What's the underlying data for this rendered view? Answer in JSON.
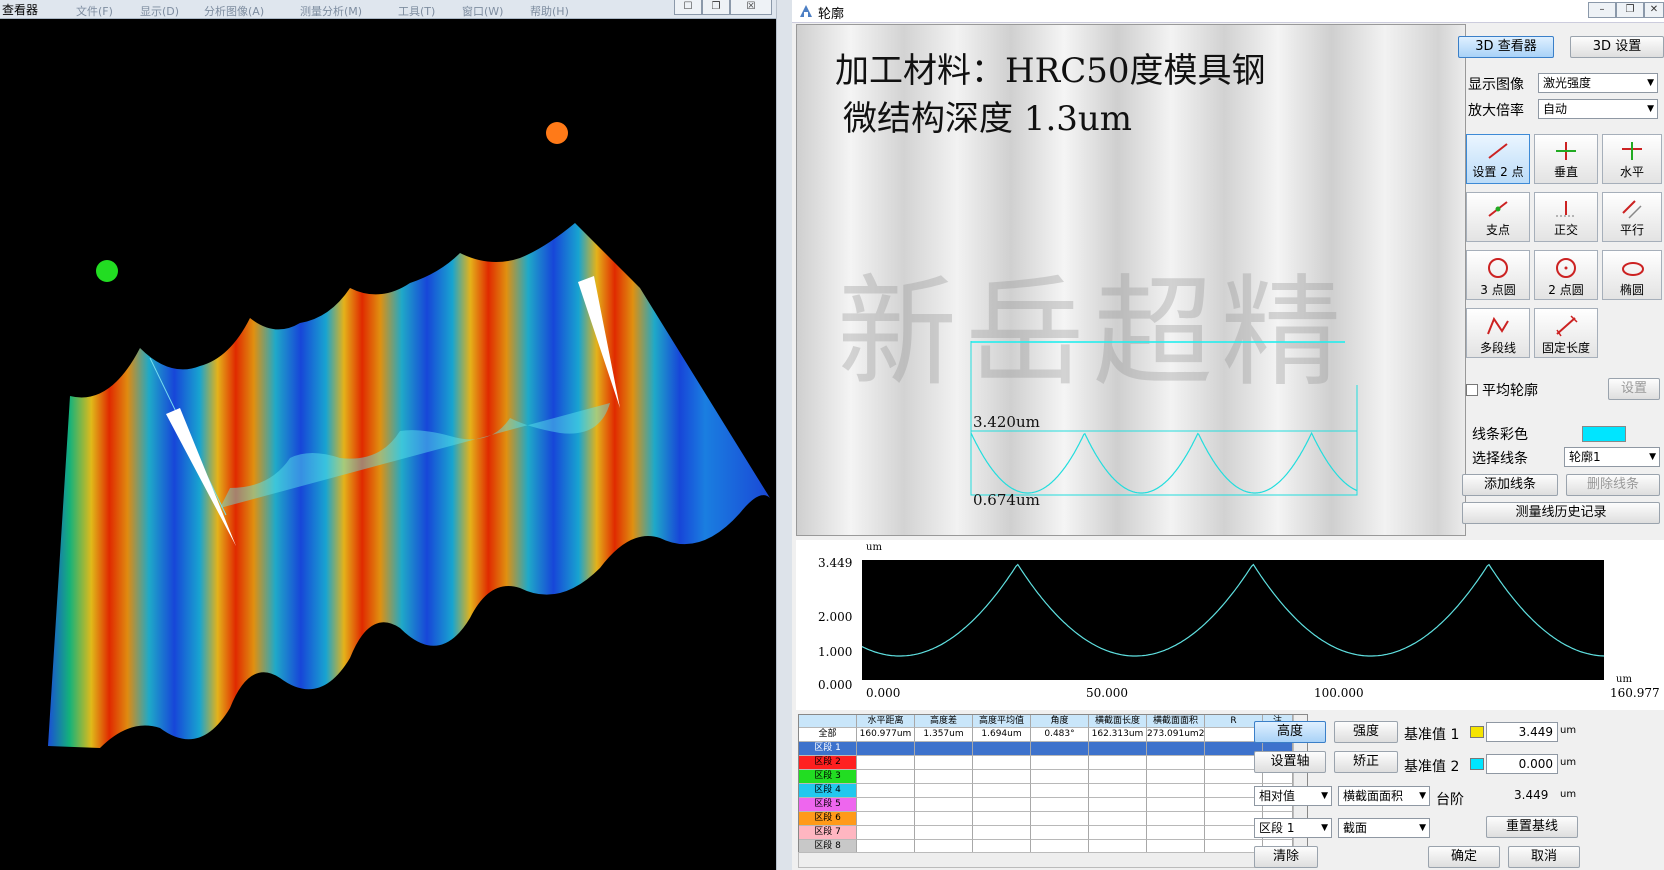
{
  "viewer": {
    "title": "查看器",
    "menu": [
      "文件(F)",
      "显示(D)",
      "分析图像(A)",
      "测量分析(M)",
      "工具(T)",
      "窗口(W)",
      "帮助(H)"
    ],
    "window_buttons": [
      "☐",
      "❐",
      "☒"
    ]
  },
  "profile": {
    "title": "轮廓",
    "window_buttons": [
      "–",
      "❐",
      "✕"
    ],
    "image": {
      "line1": "加工材料：HRC50度模具钢",
      "line2": "微结构深度 1.3um",
      "watermark": "新岳超精",
      "top_label": "3.420um",
      "bottom_label": "0.674um"
    },
    "panel": {
      "tab_3d_viewer": "3D 查看器",
      "tab_3d_settings": "3D 设置",
      "display_image_label": "显示图像",
      "display_image_value": "激光强度",
      "zoom_label": "放大倍率",
      "zoom_value": "自动",
      "tools": [
        {
          "label": "设置 2 点",
          "icon": "two-point-line-icon"
        },
        {
          "label": "垂直",
          "icon": "vertical-icon"
        },
        {
          "label": "水平",
          "icon": "horizontal-icon"
        },
        {
          "label": "支点",
          "icon": "pivot-icon"
        },
        {
          "label": "正交",
          "icon": "orthogonal-icon"
        },
        {
          "label": "平行",
          "icon": "parallel-icon"
        },
        {
          "label": "3 点圆",
          "icon": "three-point-circle-icon"
        },
        {
          "label": "2 点圆",
          "icon": "two-point-circle-icon"
        },
        {
          "label": "椭圆",
          "icon": "ellipse-icon"
        },
        {
          "label": "多段线",
          "icon": "polyline-icon"
        },
        {
          "label": "固定长度",
          "icon": "fixed-length-icon"
        }
      ],
      "average_profile_label": "平均轮廓",
      "settings_button": "设置",
      "line_color_label": "线条彩色",
      "line_color": "#00e5ff",
      "select_line_label": "选择线条",
      "select_line_value": "轮廓1",
      "add_line": "添加线条",
      "delete_line": "删除线条",
      "history": "测量线历史记录"
    },
    "graph": {
      "unit": "um",
      "y_ticks": [
        "3.449",
        "2.000",
        "1.000",
        "0.000"
      ],
      "x_ticks": [
        "0.000",
        "50.000",
        "100.000",
        "160.977"
      ],
      "x_unit": "um"
    },
    "table": {
      "headers": [
        "",
        "水平距离",
        "高度差",
        "高度平均值",
        "角度",
        "横截面长度",
        "横截面面积",
        "R",
        "注"
      ],
      "all_row": [
        "全部",
        "160.977um",
        "1.357um",
        "1.694um",
        "0.483°",
        "162.313um",
        "273.091um2",
        "",
        ""
      ],
      "segments": [
        {
          "label": "区段 1",
          "color": "#3d72cc"
        },
        {
          "label": "区段 2",
          "color": "#ff2020"
        },
        {
          "label": "区段 3",
          "color": "#22dd22"
        },
        {
          "label": "区段 4",
          "color": "#22c8ee"
        },
        {
          "label": "区段 5",
          "color": "#ee66ee"
        },
        {
          "label": "区段 6",
          "color": "#ff9a1a"
        },
        {
          "label": "区段 7",
          "color": "#ffb6c1"
        },
        {
          "label": "区段 8",
          "color": "#c8c8c8"
        }
      ]
    },
    "bottom": {
      "height_btn": "高度",
      "intensity_btn": "强度",
      "baseline1_label": "基准值 1",
      "baseline1_value": "3.449",
      "baseline1_color": "#f5e400",
      "set_axis_btn": "设置轴",
      "correct_btn": "矫正",
      "baseline2_label": "基准值 2",
      "baseline2_value": "0.000",
      "baseline2_color": "#00e5ff",
      "unit": "um",
      "relative_select": "相对值",
      "area_select": "横截面面积",
      "step_label": "台阶",
      "step_value": "3.449",
      "segment_select": "区段 1",
      "section_select": "截面",
      "reset_baseline": "重置基线",
      "clear": "清除",
      "ok": "确定",
      "cancel": "取消"
    }
  }
}
